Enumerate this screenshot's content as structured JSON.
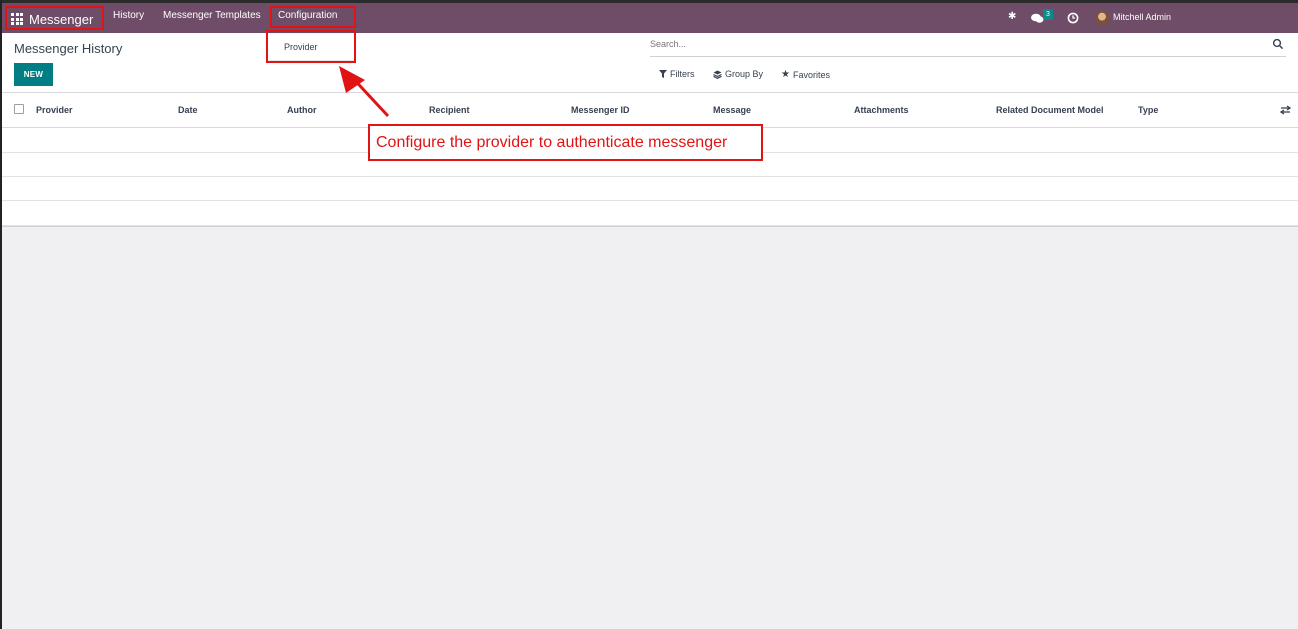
{
  "navbar": {
    "app_name": "Messenger",
    "menu": [
      "History",
      "Messenger Templates",
      "Configuration"
    ],
    "chat_badge": "3",
    "user_name": "Mitchell Admin"
  },
  "dropdown": {
    "items": [
      "Provider"
    ]
  },
  "control_panel": {
    "title": "Messenger History",
    "new_label": "NEW",
    "search_placeholder": "Search...",
    "filters_label": "Filters",
    "group_by_label": "Group By",
    "favorites_label": "Favorites"
  },
  "table": {
    "columns": [
      "Provider",
      "Date",
      "Author",
      "Recipient",
      "Messenger ID",
      "Message",
      "Attachments",
      "Related Document Model",
      "Type"
    ],
    "empty_rows": 4
  },
  "annotation": {
    "text": "Configure the provider to authenticate messenger"
  },
  "colors": {
    "navbar": "#6f4c67",
    "primary": "#017e84",
    "annotation": "#e01414",
    "badge": "#0b8a8a"
  },
  "icons": [
    "apps-grid-icon",
    "bug-icon",
    "chat-icon",
    "clock-icon",
    "search-icon",
    "filter-icon",
    "layers-icon",
    "star-icon",
    "column-settings-icon"
  ]
}
